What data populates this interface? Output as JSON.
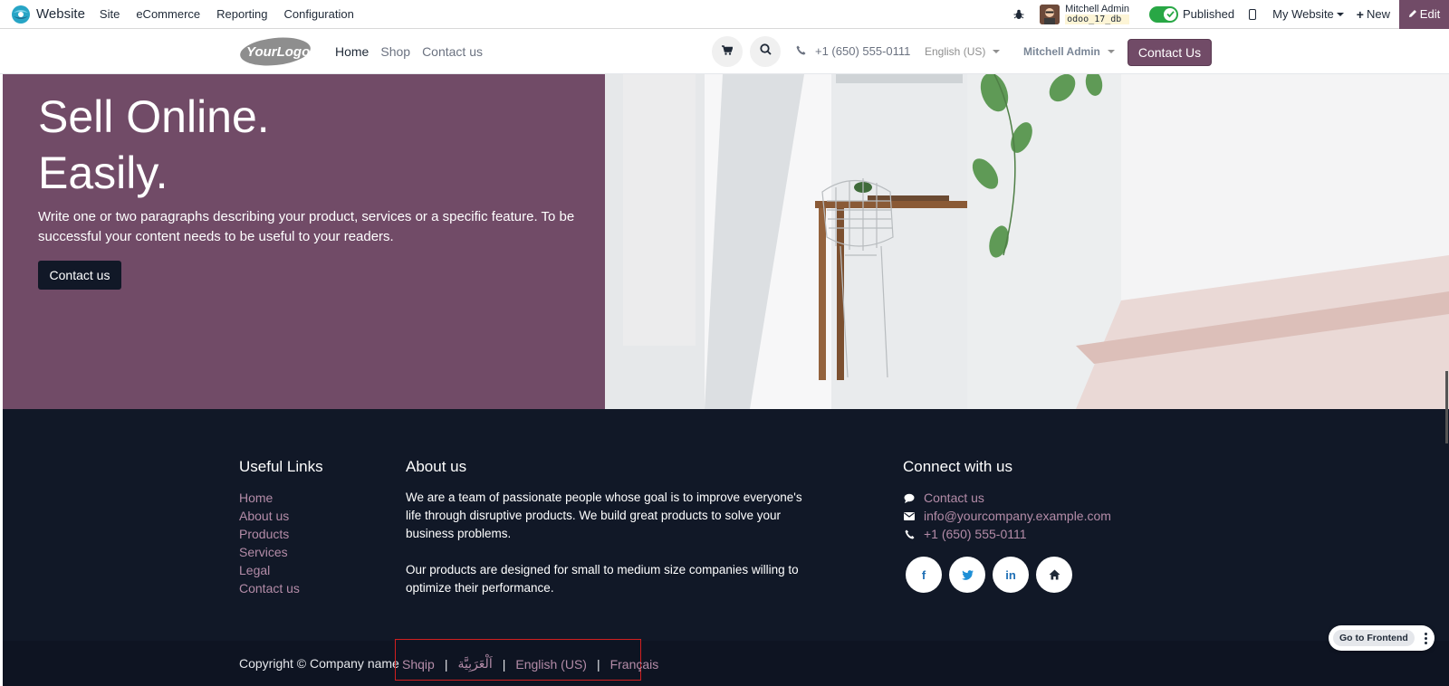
{
  "admin_bar": {
    "app_name": "Website",
    "menu": [
      "Site",
      "eCommerce",
      "Reporting",
      "Configuration"
    ],
    "user_name": "Mitchell Admin",
    "db_name": "odoo_17_db",
    "published_label": "Published",
    "my_website_label": "My Website",
    "new_label": "New",
    "edit_label": "Edit"
  },
  "header": {
    "logo_text": "YourLogo",
    "nav": [
      "Home",
      "Shop",
      "Contact us"
    ],
    "phone": "+1 (650) 555-0111",
    "language": "English (US)",
    "user": "Mitchell Admin",
    "cta_label": "Contact Us"
  },
  "hero": {
    "title_line1": "Sell Online.",
    "title_line2": "Easily.",
    "text": "Write one or two paragraphs describing your product, services or a specific feature. To be successful your content needs to be useful to your readers.",
    "button_label": "Contact us"
  },
  "footer": {
    "useful_links_title": "Useful Links",
    "useful_links": [
      "Home",
      "About us",
      "Products",
      "Services",
      "Legal",
      "Contact us"
    ],
    "about_title": "About us",
    "about_p1": "We are a team of passionate people whose goal is to improve everyone's life through disruptive products. We build great products to solve your business problems.",
    "about_p2": "Our products are designed for small to medium size companies willing to optimize their performance.",
    "connect_title": "Connect with us",
    "connect_contact": "Contact us",
    "connect_email": "info@yourcompany.example.com",
    "connect_phone": "+1 (650) 555-0111",
    "copyright": "Copyright © Company name",
    "languages": [
      "Shqip",
      "اَلْعَرَبِيَّة",
      "English (US)",
      "Français"
    ]
  },
  "floating": {
    "go_to_frontend": "Go to Frontend"
  },
  "colors": {
    "brand_purple": "#714b67",
    "footer_dark": "#111827",
    "link_purple": "#b48ca8",
    "highlight_red": "#d11f1f"
  }
}
